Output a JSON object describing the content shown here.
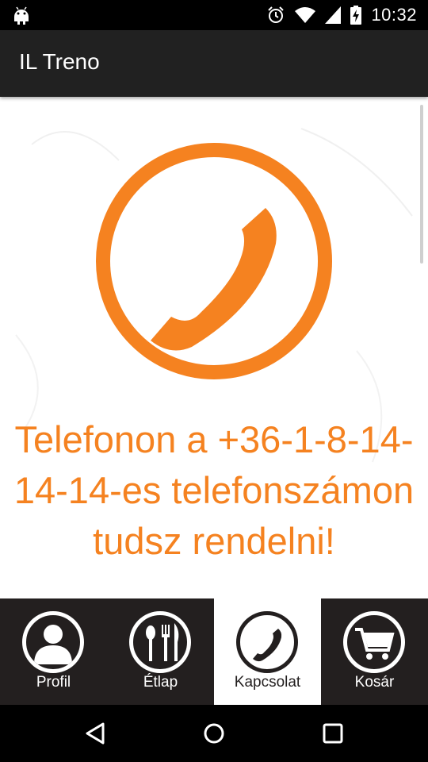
{
  "status_bar": {
    "time": "10:32",
    "icons": [
      "android-icon",
      "alarm-icon",
      "wifi-icon",
      "signal-icon",
      "battery-charging-icon"
    ]
  },
  "app_bar": {
    "title": "IL Treno"
  },
  "main": {
    "emblem_icon": "phone-handset-icon",
    "message": "Telefonon a +36-1-8-14-14-14-es telefonszámon tudsz rendelni!"
  },
  "bottom_nav": {
    "items": [
      {
        "label": "Profil",
        "icon": "person-icon"
      },
      {
        "label": "Étlap",
        "icon": "cutlery-icon"
      },
      {
        "label": "Kapcsolat",
        "icon": "phone-icon",
        "active": true
      },
      {
        "label": "Kosár",
        "icon": "shopping-cart-icon"
      }
    ]
  },
  "colors": {
    "accent": "#f58220",
    "app_bar": "#212121",
    "bottom_nav_bg": "#231f1f",
    "active_tab_bg": "#ffffff"
  }
}
